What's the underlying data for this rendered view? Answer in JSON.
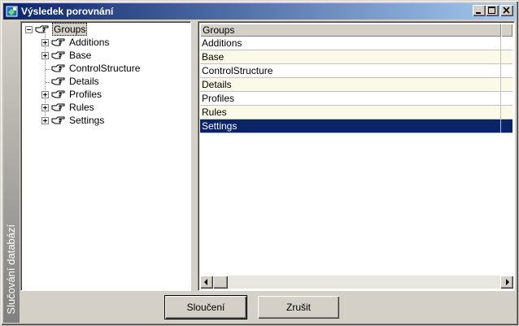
{
  "window": {
    "title": "Výsledek porovnání",
    "side_caption": "Slučování databází"
  },
  "tree": {
    "root": {
      "label": "Groups",
      "expanded": true,
      "selected": true
    },
    "items": [
      {
        "label": "Additions",
        "expandable": true
      },
      {
        "label": "Base",
        "expandable": true
      },
      {
        "label": "ControlStructure",
        "expandable": false
      },
      {
        "label": "Details",
        "expandable": false
      },
      {
        "label": "Profiles",
        "expandable": true
      },
      {
        "label": "Rules",
        "expandable": true
      },
      {
        "label": "Settings",
        "expandable": true
      }
    ]
  },
  "grid": {
    "header": "Groups",
    "rows": [
      "Additions",
      "Base",
      "ControlStructure",
      "Details",
      "Profiles",
      "Rules",
      "Settings"
    ],
    "selected_row": "Settings"
  },
  "buttons": {
    "merge": "Sloučení",
    "cancel": "Zrušit"
  },
  "colors": {
    "titlebar_start": "#0a246a",
    "titlebar_end": "#a6caf0",
    "selection": "#0a246a",
    "row_alt": "#fbfae8"
  },
  "icons": {
    "app": "compare-app-icon",
    "tree_node": "pointing-hand-icon",
    "minimize": "minimize-icon",
    "maximize": "maximize-icon",
    "close": "close-icon",
    "scroll_left": "arrow-left-icon",
    "scroll_right": "arrow-right-icon"
  }
}
